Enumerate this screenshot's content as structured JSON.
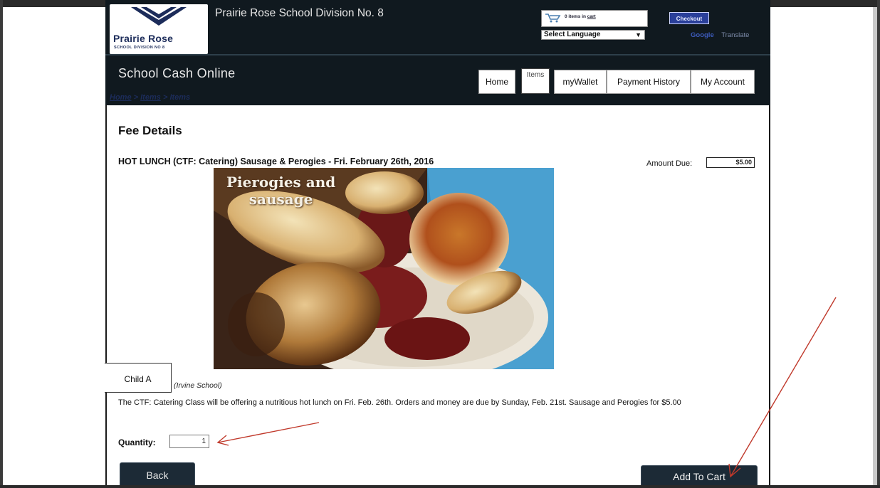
{
  "header": {
    "division_title": "Prairie Rose School Division No. 8",
    "logo_name": "Prairie Rose",
    "logo_sub": "SCHOOL DIVISION NO 8",
    "app_title": "School Cash Online"
  },
  "cart": {
    "count_text": "0 items in",
    "cart_link": "cart",
    "checkout_label": "Checkout"
  },
  "language": {
    "selected": "Select Language",
    "translate_label": "Translate",
    "translate_brand": "Google"
  },
  "nav": {
    "home": "Home",
    "items": "Items",
    "mywallet": "myWallet",
    "payment_history": "Payment History",
    "my_account": "My Account"
  },
  "breadcrumb": {
    "home": "Home",
    "items1": "Items",
    "items2": "Items",
    "sep": ">"
  },
  "fee": {
    "section_title": "Fee Details",
    "item_title": "HOT LUNCH (CTF: Catering) Sausage & Perogies - Fri. February 26th, 2016",
    "amount_label": "Amount Due:",
    "amount_value": "$5.00",
    "photo_caption_line1": "Pierogies and",
    "photo_caption_line2": "sausage",
    "child_name": "Child A",
    "school_name": "(Irvine School)",
    "description": "The CTF: Catering Class will be offering a nutritious hot lunch on Fri. Feb. 26th. Orders and money are due by Sunday, Feb. 21st. Sausage and Perogies for $5.00",
    "quantity_label": "Quantity:",
    "quantity_value": "1"
  },
  "actions": {
    "back": "Back",
    "add_to_cart": "Add To Cart"
  },
  "colors": {
    "header_bg": "#10191f",
    "button_bg": "#1c2a36",
    "annotation_arrow": "#c0392b"
  }
}
